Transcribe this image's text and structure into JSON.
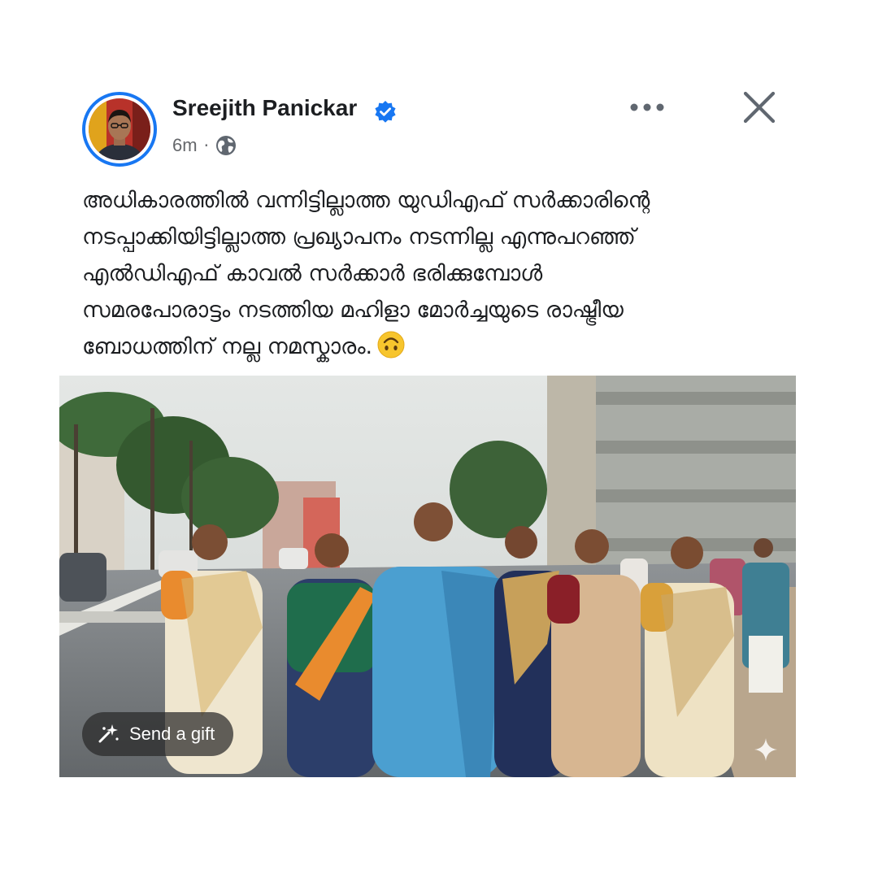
{
  "post": {
    "author": "Sreejith Panickar",
    "verified": true,
    "timestamp": "6m",
    "separator": "·",
    "audience_icon": "globe-icon",
    "text_lines": [
      "അധികാരത്തിൽ വന്നിട്ടില്ലാത്ത യുഡിഎഫ് സർക്കാരിന്റെ",
      "നടപ്പാക്കിയിട്ടില്ലാത്ത പ്രഖ്യാപനം നടന്നില്ല എന്നുപറഞ്ഞ്",
      "എൽഡിഎഫ് കാവൽ സർക്കാർ ഭരിക്കുമ്പോൾ",
      "സമരപോരാട്ടം നടത്തിയ മഹിളാ മോർച്ചയുടെ രാഷ്ട്രീയ",
      "ബോധത്തിന് നല്ല നമസ്കാരം."
    ],
    "trailing_emoji": "upside-down-face-emoji"
  },
  "header_actions": {
    "more_icon": "more-horizontal-icon",
    "close_icon": "close-icon"
  },
  "media": {
    "gift_button_label": "Send a gift",
    "gift_icon": "gift-sparkle-icon",
    "watermark_icon": "ai-sparkle-icon"
  },
  "colors": {
    "brand_blue": "#1877f2",
    "text_primary": "#1c1e21",
    "text_secondary": "#65676b",
    "icon_gray": "#606770"
  }
}
